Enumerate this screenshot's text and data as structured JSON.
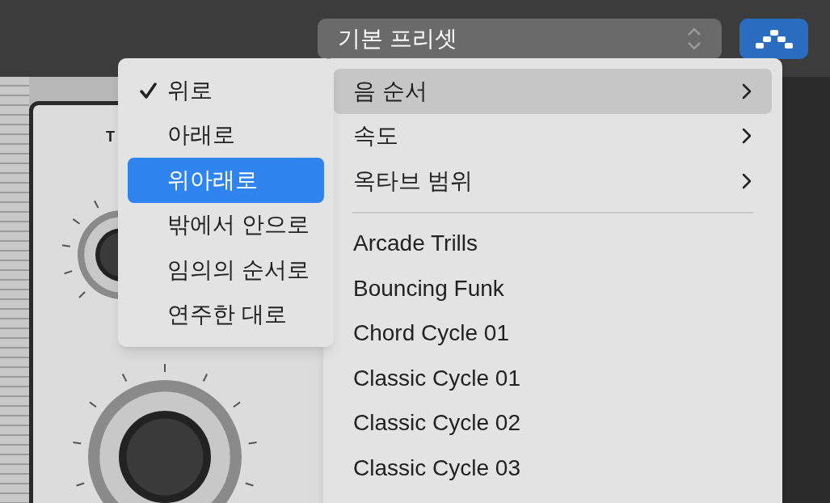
{
  "preset_selector": {
    "value": "기본 프리셋"
  },
  "arpeggiator_button": {
    "on": true
  },
  "panel": {
    "label": "T"
  },
  "main_menu": {
    "items": [
      {
        "kind": "submenu",
        "label": "음 순서",
        "selected": true
      },
      {
        "kind": "submenu",
        "label": "속도",
        "selected": false
      },
      {
        "kind": "submenu",
        "label": "옥타브 범위",
        "selected": false
      },
      {
        "kind": "divider"
      },
      {
        "kind": "preset",
        "label": "Arcade Trills",
        "selected": false
      },
      {
        "kind": "preset",
        "label": "Bouncing Funk",
        "selected": false
      },
      {
        "kind": "preset",
        "label": "Chord Cycle 01",
        "selected": false
      },
      {
        "kind": "preset",
        "label": "Classic Cycle 01",
        "selected": false
      },
      {
        "kind": "preset",
        "label": "Classic Cycle 02",
        "selected": false
      },
      {
        "kind": "preset",
        "label": "Classic Cycle 03",
        "selected": false
      }
    ]
  },
  "submenu": {
    "items": [
      {
        "label": "위로",
        "checked": true,
        "selected": false
      },
      {
        "label": "아래로",
        "checked": false,
        "selected": false
      },
      {
        "label": "위아래로",
        "checked": false,
        "selected": true
      },
      {
        "label": "밖에서 안으로",
        "checked": false,
        "selected": false
      },
      {
        "label": "임의의 순서로",
        "checked": false,
        "selected": false
      },
      {
        "label": "연주한 대로",
        "checked": false,
        "selected": false
      }
    ]
  }
}
